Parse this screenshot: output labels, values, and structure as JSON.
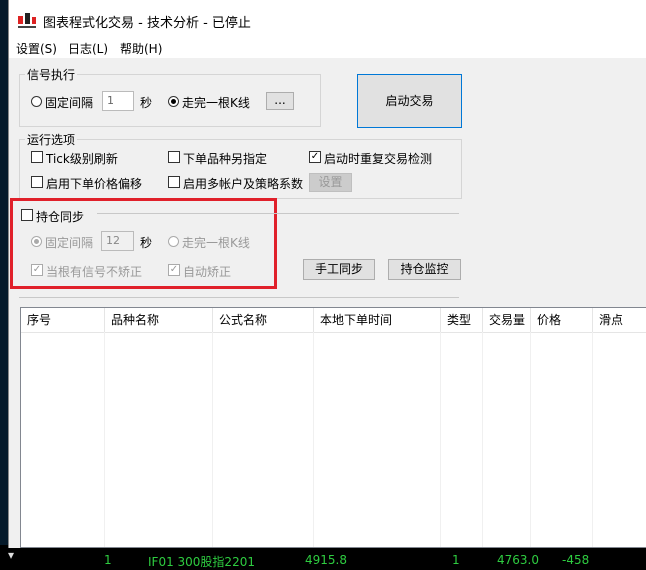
{
  "window": {
    "title": "图表程式化交易 - 技术分析 - 已停止"
  },
  "menu": [
    {
      "label": "设置(S)"
    },
    {
      "label": "日志(L)"
    },
    {
      "label": "帮助(H)"
    }
  ],
  "signal": {
    "title": "信号执行",
    "fixed_label": "固定间隔",
    "interval_value": "1",
    "unit": "秒",
    "bar_label": "走完一根K线",
    "more_label": "...",
    "selected": "bar"
  },
  "start_button": "启动交易",
  "run": {
    "title": "运行选项",
    "tick_refresh": "Tick级别刷新",
    "order_variety": "下单品种另指定",
    "restart_check": "启动时重复交易检测",
    "price_offset": "启用下单价格偏移",
    "multi_account": "启用多帐户及策略系数",
    "settings_btn": "设置",
    "restart_checked": true
  },
  "position": {
    "title": "持仓同步",
    "fixed_label": "固定间隔",
    "interval_value": "12",
    "unit": "秒",
    "bar_label": "走完一根K线",
    "no_correct": "当根有信号不矫正",
    "auto_correct": "自动矫正",
    "manual_sync": "手工同步",
    "monitor": "持仓监控"
  },
  "table": {
    "columns": [
      "序号",
      "品种名称",
      "公式名称",
      "本地下单时间",
      "类型",
      "交易量",
      "价格",
      "滑点"
    ]
  },
  "background_row": {
    "index": "1",
    "name": "IF01 300股指2201",
    "time": "4915.8",
    "type": "1",
    "price": "4763.0",
    "slip": "-458"
  },
  "colors": {
    "accent": "#0078d7",
    "highlight": "#e0202a",
    "bg_green": "#22c55e"
  }
}
